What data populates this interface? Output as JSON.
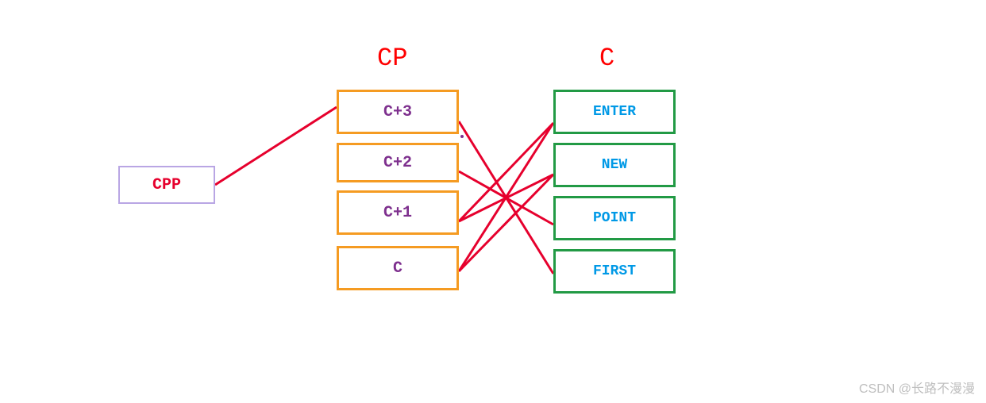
{
  "colors": {
    "red": "#e6002d",
    "orange_border": "#f59b22",
    "green_border": "#229a45",
    "purple_border": "#b9a6e4",
    "purple_text": "#7e308e",
    "blue_text": "#0099e6",
    "header_red": "#ff0000",
    "watermark_gray": "#bfbfbf"
  },
  "headers": {
    "cp": "CP",
    "c": "C"
  },
  "cpp_box": {
    "label": "CPP"
  },
  "cp_column": {
    "items": [
      "C+3",
      "C+2",
      "C+1",
      "C"
    ]
  },
  "c_column": {
    "items": [
      "ENTER",
      "NEW",
      "POINT",
      "FIRST"
    ]
  },
  "watermark": "CSDN @长路不漫漫",
  "chart_data": {
    "type": "diagram",
    "description": "Pointer diagram: CPP points to top of CP array; CP array cells (C+3..C) cross-link to C array cells (ENTER, NEW, POINT, FIRST)",
    "nodes": [
      {
        "id": "CPP",
        "group": "cpp",
        "label": "CPP"
      },
      {
        "id": "CP0",
        "group": "cp",
        "label": "C+3"
      },
      {
        "id": "CP1",
        "group": "cp",
        "label": "C+2"
      },
      {
        "id": "CP2",
        "group": "cp",
        "label": "C+1"
      },
      {
        "id": "CP3",
        "group": "cp",
        "label": "C"
      },
      {
        "id": "C0",
        "group": "c",
        "label": "ENTER"
      },
      {
        "id": "C1",
        "group": "c",
        "label": "NEW"
      },
      {
        "id": "C2",
        "group": "c",
        "label": "POINT"
      },
      {
        "id": "C3",
        "group": "c",
        "label": "FIRST"
      }
    ],
    "edges": [
      {
        "from": "CPP",
        "to": "CP0"
      },
      {
        "from": "CP0",
        "to": "C3"
      },
      {
        "from": "CP1",
        "to": "C2"
      },
      {
        "from": "CP2",
        "to": "C1"
      },
      {
        "from": "CP2",
        "to": "C0"
      },
      {
        "from": "CP3",
        "to": "C1"
      },
      {
        "from": "CP3",
        "to": "C0"
      }
    ]
  }
}
